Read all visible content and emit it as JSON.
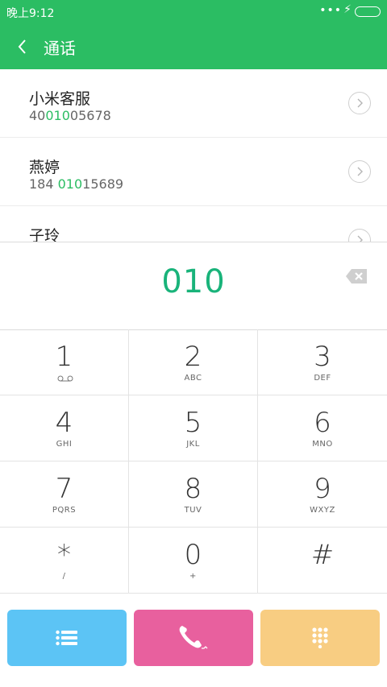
{
  "status_bar": {
    "time": "晚上9:12",
    "dots": "•••",
    "bolt": "⚡"
  },
  "header": {
    "title": "通话"
  },
  "contacts": [
    {
      "name": "小米客服",
      "number_prefix": "40",
      "number_match": "010",
      "number_suffix": "05678"
    },
    {
      "name": "燕婷",
      "number_prefix": "184 ",
      "number_match": "010",
      "number_suffix": "15689"
    },
    {
      "name": "子玲",
      "number_prefix": "",
      "number_match": "",
      "number_suffix": ""
    }
  ],
  "dialer": {
    "input": "010"
  },
  "keypad": [
    {
      "digit": "1",
      "letters": ""
    },
    {
      "digit": "2",
      "letters": "ABC"
    },
    {
      "digit": "3",
      "letters": "DEF"
    },
    {
      "digit": "4",
      "letters": "GHI"
    },
    {
      "digit": "5",
      "letters": "JKL"
    },
    {
      "digit": "6",
      "letters": "MNO"
    },
    {
      "digit": "7",
      "letters": "PQRS"
    },
    {
      "digit": "8",
      "letters": "TUV"
    },
    {
      "digit": "9",
      "letters": "WXYZ"
    },
    {
      "digit": "*",
      "letters": "/"
    },
    {
      "digit": "0",
      "letters": "+"
    },
    {
      "digit": "#",
      "letters": ""
    }
  ],
  "colors": {
    "header": "#2bbd63",
    "match_text": "#2bbd63",
    "input_text": "#19b37a",
    "menu_button": "#5cc4f5",
    "call_button": "#e8609e",
    "keypad_button": "#f8cd82"
  },
  "icons": {
    "back": "chevron-left-icon",
    "detail": "chevron-right-circle-icon",
    "backspace": "backspace-icon",
    "voicemail": "voicemail-icon",
    "menu": "list-icon",
    "call": "phone-icon",
    "keypad": "dialpad-icon"
  }
}
